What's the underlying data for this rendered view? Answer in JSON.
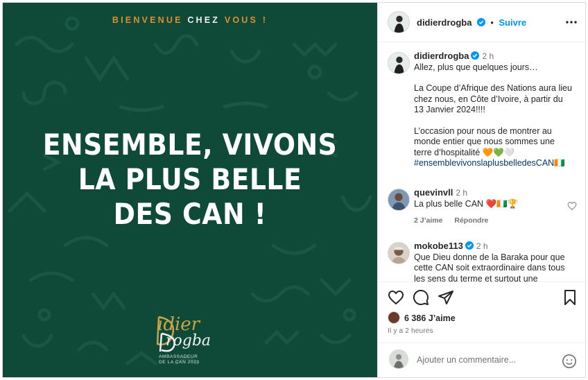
{
  "post_image": {
    "welcome": {
      "part1": "BIENVENUE",
      "part2": "CHEZ",
      "part3": "VOUS !"
    },
    "headline": [
      "ENSEMBLE, VIVONS",
      "LA PLUS BELLE",
      "DES CAN !"
    ],
    "signature": {
      "line1": "idier",
      "line2": "rogba",
      "sub1": "AMBASSADEUR",
      "sub2": "DE LA CAN 2023"
    },
    "colors": {
      "background": "#0e4a37",
      "accent_orange": "#e08f2c"
    }
  },
  "header": {
    "username": "didierdrogba",
    "separator": "•",
    "follow_label": "Suivre",
    "more_icon": "more-horizontal-icon"
  },
  "caption": {
    "username": "didierdrogba",
    "time": "2 h",
    "line1": "Allez, plus que quelques jours…",
    "paragraph2": "La Coupe d’Afrique des Nations aura lieu chez nous, en Côte d’Ivoire, à partir du 13 Janvier 2024!!!!",
    "paragraph3": "L’occasion pour nous de montrer au monde entier que nous sommes une terre d’hospitalité 🧡💚🤍",
    "hashtag": "#ensemblevivonslaplusbelledesCAN🇨🇮"
  },
  "comments": [
    {
      "username": "quevinvll",
      "time": "2 h",
      "text": "La plus belle CAN ❤️🇨🇮🏆",
      "likes_label": "2 J’aime",
      "reply_label": "Répondre"
    },
    {
      "username": "mokobe113",
      "time": "2 h",
      "text": "Que Dieu donne de la Baraka pour que cette CAN soit extraordinaire dans tous les sens du terme et surtout une"
    }
  ],
  "actions": {
    "likes_count": "6 386 J’aime",
    "posted_ago": "Il y a 2 heures"
  },
  "add_comment": {
    "placeholder": "Ajouter un commentaire..."
  },
  "colors": {
    "link_blue": "#0095f6",
    "hashtag": "#00376b",
    "muted": "#737373"
  }
}
